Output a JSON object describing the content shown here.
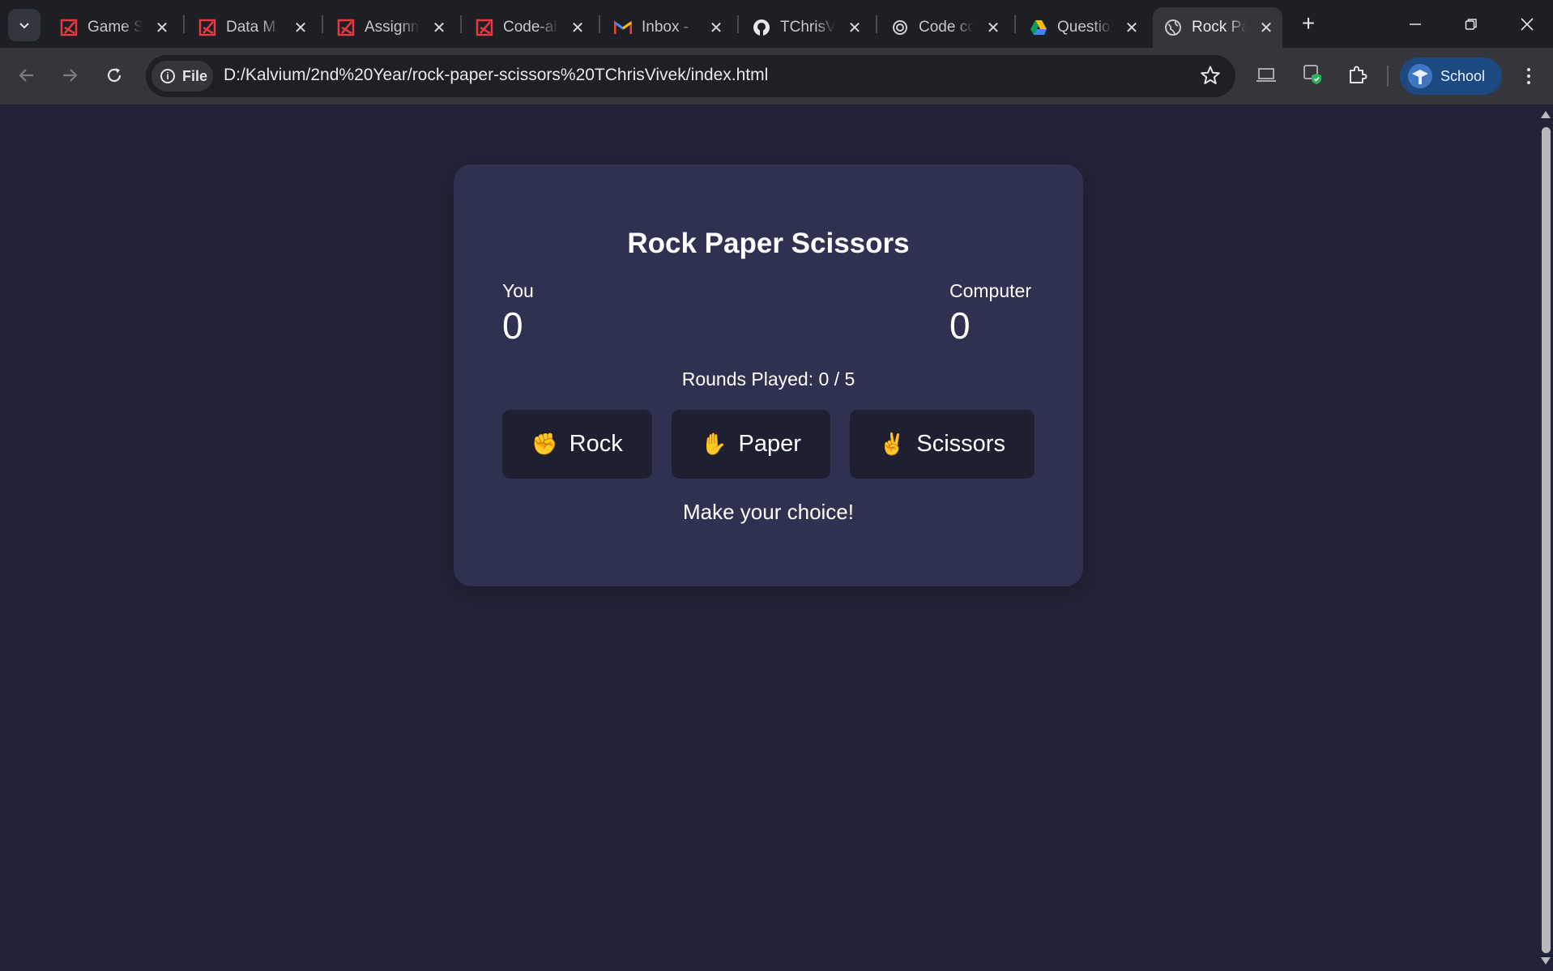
{
  "browser": {
    "tabs": [
      {
        "title": "Game S",
        "favicon": "kalvium-icon"
      },
      {
        "title": "Data M",
        "favicon": "kalvium-icon"
      },
      {
        "title": "Assignm",
        "favicon": "kalvium-icon"
      },
      {
        "title": "Code-al",
        "favicon": "kalvium-icon"
      },
      {
        "title": "Inbox -",
        "favicon": "gmail-icon"
      },
      {
        "title": "TChrisV",
        "favicon": "github-icon"
      },
      {
        "title": "Code cc",
        "favicon": "chatgpt-icon"
      },
      {
        "title": "Questio",
        "favicon": "drive-icon"
      },
      {
        "title": "Rock Pa",
        "favicon": "globe-icon",
        "active": true
      }
    ],
    "close_glyph": "✕",
    "new_tab_glyph": "+",
    "site_chip": "File",
    "url": "D:/Kalvium/2nd%20Year/rock-paper-scissors%20TChrisVivek/index.html",
    "profile_label": "School"
  },
  "game": {
    "title": "Rock Paper Scissors",
    "player_label": "You",
    "player_score": "0",
    "computer_label": "Computer",
    "computer_score": "0",
    "rounds_text": "Rounds Played: 0 / 5",
    "choices": [
      {
        "emoji": "✊",
        "label": "Rock"
      },
      {
        "emoji": "✋",
        "label": "Paper"
      },
      {
        "emoji": "✌️",
        "label": "Scissors"
      }
    ],
    "result_text": "Make your choice!"
  },
  "colors": {
    "page_bg": "#222338",
    "card_bg": "#2e3150",
    "button_bg": "#1e1f31",
    "text": "#ffffff",
    "profile_bg": "#1c4a80"
  }
}
